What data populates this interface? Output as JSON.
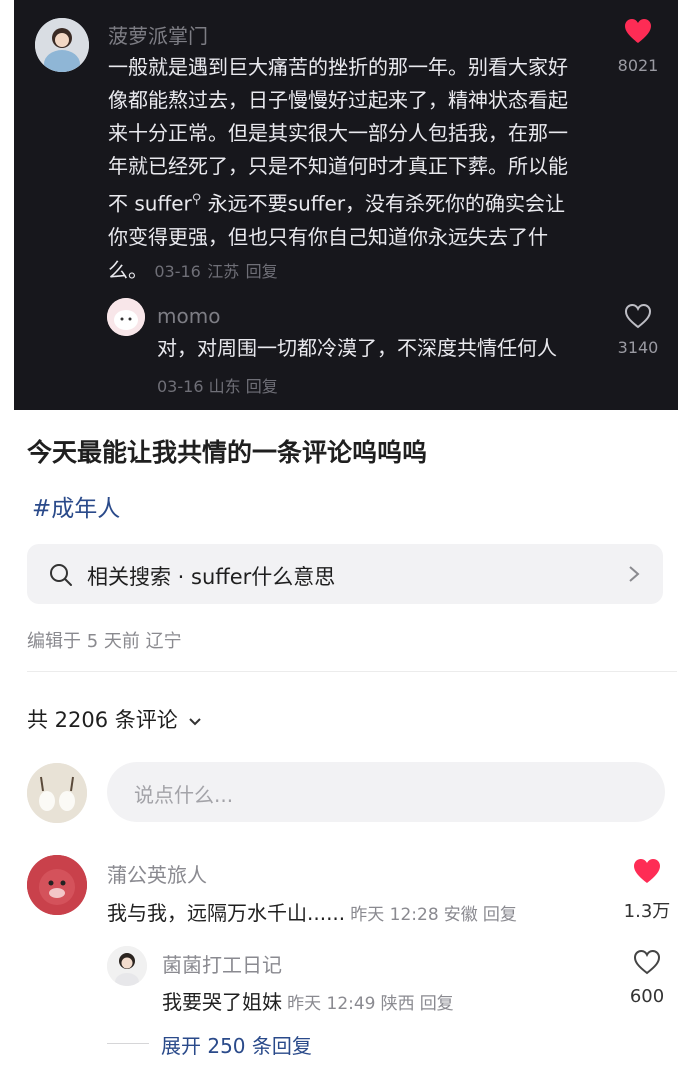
{
  "colors": {
    "dark_bg": "#17171c",
    "heart_red": "#fe2c55",
    "tag_blue": "#2a4a8a"
  },
  "screenshot_post": {
    "comment1": {
      "user": "菠萝派掌门",
      "text_lines": [
        "一般就是遇到巨大痛苦的挫折的那一年。别看大家好",
        "像都能熬过去，日子慢慢好过起来了，精神状态看起",
        "来十分正常。但是其实很大一部分人包括我，在那一",
        "年就已经死了，只是不知道何时才真正下葬。所以能"
      ],
      "line5_a": "不 suffer",
      "line5_b": " 永远不要suffer，没有杀死你的确实会让",
      "line6": "你变得更强，但也只有你自己知道你永远失去了什",
      "line7": "么。",
      "date": "03-16",
      "location": "江苏",
      "reply": "回复",
      "likes": "8021"
    },
    "comment2": {
      "user": "momo",
      "text": "对，对周围一切都冷漠了，不深度共情任何人",
      "date": "03-16",
      "location": "山东",
      "reply": "回复",
      "likes": "3140"
    }
  },
  "post": {
    "title": "今天最能让我共情的一条评论呜呜呜",
    "hashtag": "#成年人",
    "related_search": "相关搜索 · suffer什么意思",
    "edited": "编辑于 5 天前 辽宁"
  },
  "comments": {
    "count_label": "共 2206 条评论",
    "input_placeholder": "说点什么...",
    "items": [
      {
        "user": "蒲公英旅人",
        "text": "我与我，远隔万水千山......",
        "time": "昨天 12:28",
        "location": "安徽",
        "reply": "回复",
        "likes": "1.3万"
      },
      {
        "user": "菌菌打工日记",
        "text": "我要哭了姐妹",
        "time": "昨天 12:49",
        "location": "陕西",
        "reply": "回复",
        "likes": "600"
      }
    ],
    "expand": "展开 250 条回复"
  }
}
